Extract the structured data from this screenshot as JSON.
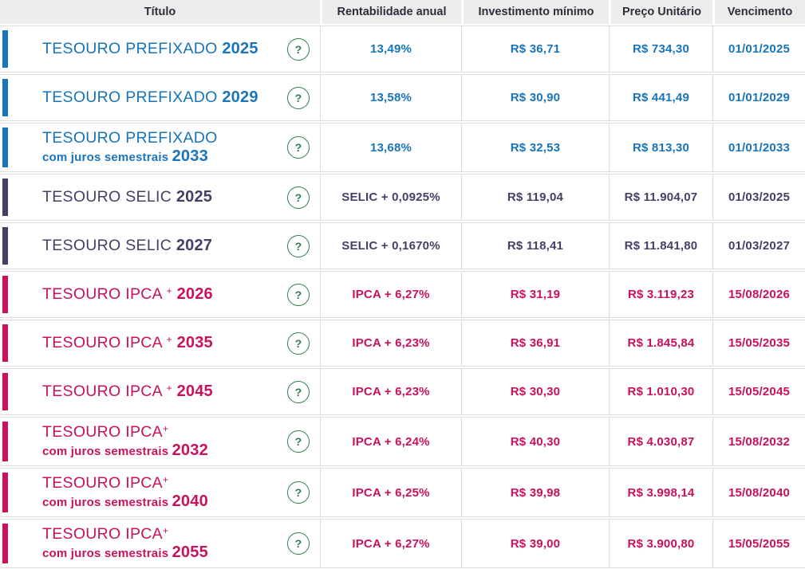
{
  "colors": {
    "prefixado": "#1874bb",
    "selic": "#453f66",
    "ipca": "#c9115c",
    "help_green": "#2f7d4d",
    "header_bg": "#ececec",
    "border": "#dcdcdc"
  },
  "icons": {
    "help": "?"
  },
  "table": {
    "columns": [
      "Título",
      "Rentabilidade anual",
      "Investimento mínimo",
      "Preço Unitário",
      "Vencimento"
    ],
    "rows": [
      {
        "theme": "prefixado",
        "title": "TESOURO PREFIXADO",
        "sup": "",
        "subtitle": "",
        "year": "2025",
        "rate": "13,49%",
        "min_investment": "R$ 36,71",
        "unit_price": "R$ 734,30",
        "maturity": "01/01/2025"
      },
      {
        "theme": "prefixado",
        "title": "TESOURO PREFIXADO",
        "sup": "",
        "subtitle": "",
        "year": "2029",
        "rate": "13,58%",
        "min_investment": "R$ 30,90",
        "unit_price": "R$ 441,49",
        "maturity": "01/01/2029"
      },
      {
        "theme": "prefixado",
        "title": "TESOURO PREFIXADO",
        "sup": "",
        "subtitle": "com juros semestrais",
        "year": "2033",
        "rate": "13,68%",
        "min_investment": "R$ 32,53",
        "unit_price": "R$ 813,30",
        "maturity": "01/01/2033"
      },
      {
        "theme": "selic",
        "title": "TESOURO SELIC",
        "sup": "",
        "subtitle": "",
        "year": "2025",
        "rate": "SELIC + 0,0925%",
        "min_investment": "R$ 119,04",
        "unit_price": "R$ 11.904,07",
        "maturity": "01/03/2025"
      },
      {
        "theme": "selic",
        "title": "TESOURO SELIC",
        "sup": "",
        "subtitle": "",
        "year": "2027",
        "rate": "SELIC + 0,1670%",
        "min_investment": "R$ 118,41",
        "unit_price": "R$ 11.841,80",
        "maturity": "01/03/2027"
      },
      {
        "theme": "ipca",
        "title": "TESOURO IPCA",
        "sup": "+",
        "subtitle": "",
        "year": "2026",
        "rate": "IPCA + 6,27%",
        "min_investment": "R$ 31,19",
        "unit_price": "R$ 3.119,23",
        "maturity": "15/08/2026"
      },
      {
        "theme": "ipca",
        "title": "TESOURO IPCA",
        "sup": "+",
        "subtitle": "",
        "year": "2035",
        "rate": "IPCA + 6,23%",
        "min_investment": "R$ 36,91",
        "unit_price": "R$ 1.845,84",
        "maturity": "15/05/2035"
      },
      {
        "theme": "ipca",
        "title": "TESOURO IPCA",
        "sup": "+",
        "subtitle": "",
        "year": "2045",
        "rate": "IPCA + 6,23%",
        "min_investment": "R$ 30,30",
        "unit_price": "R$ 1.010,30",
        "maturity": "15/05/2045"
      },
      {
        "theme": "ipca",
        "title": "TESOURO IPCA",
        "sup": "+",
        "subtitle": "com juros semestrais",
        "year": "2032",
        "rate": "IPCA + 6,24%",
        "min_investment": "R$ 40,30",
        "unit_price": "R$ 4.030,87",
        "maturity": "15/08/2032"
      },
      {
        "theme": "ipca",
        "title": "TESOURO IPCA",
        "sup": "+",
        "subtitle": "com juros semestrais",
        "year": "2040",
        "rate": "IPCA + 6,25%",
        "min_investment": "R$ 39,98",
        "unit_price": "R$ 3.998,14",
        "maturity": "15/08/2040"
      },
      {
        "theme": "ipca",
        "title": "TESOURO IPCA",
        "sup": "+",
        "subtitle": "com juros semestrais",
        "year": "2055",
        "rate": "IPCA + 6,27%",
        "min_investment": "R$ 39,00",
        "unit_price": "R$ 3.900,80",
        "maturity": "15/05/2055"
      }
    ]
  }
}
